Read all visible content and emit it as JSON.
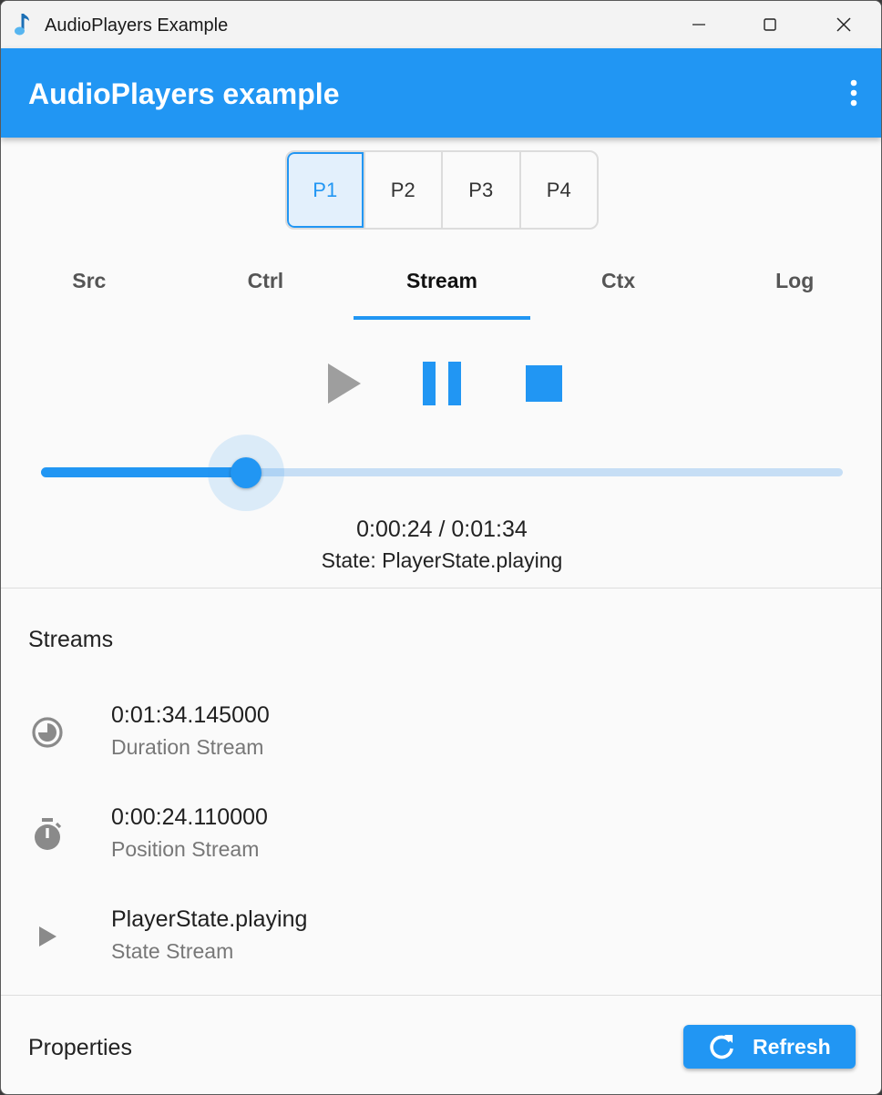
{
  "window": {
    "title": "AudioPlayers Example",
    "icon": "music-note-icon"
  },
  "appbar": {
    "title": "AudioPlayers example",
    "menu_icon": "more-vert-icon"
  },
  "players": {
    "options": [
      "P1",
      "P2",
      "P3",
      "P4"
    ],
    "selected": "P1"
  },
  "tabs": {
    "items": [
      "Src",
      "Ctrl",
      "Stream",
      "Ctx",
      "Log"
    ],
    "selected": "Stream"
  },
  "controls": {
    "play_icon": "play-icon",
    "pause_icon": "pause-icon",
    "stop_icon": "stop-icon"
  },
  "slider": {
    "position_seconds": 24,
    "duration_seconds": 94
  },
  "playback": {
    "time": "0:00:24 / 0:01:34",
    "state": "State: PlayerState.playing"
  },
  "streams": {
    "title": "Streams",
    "items": [
      {
        "icon": "timelapse-icon",
        "value": "0:01:34.145000",
        "label": "Duration Stream"
      },
      {
        "icon": "timer-icon",
        "value": "0:00:24.110000",
        "label": "Position Stream"
      },
      {
        "icon": "play-arrow-icon",
        "value": "PlayerState.playing",
        "label": "State Stream"
      }
    ]
  },
  "properties": {
    "title": "Properties",
    "refresh_label": "Refresh",
    "refresh_icon": "refresh-icon"
  },
  "colors": {
    "primary": "#2196f3",
    "primary_light": "#c6def5",
    "icon_gray": "#8a8a8a"
  }
}
